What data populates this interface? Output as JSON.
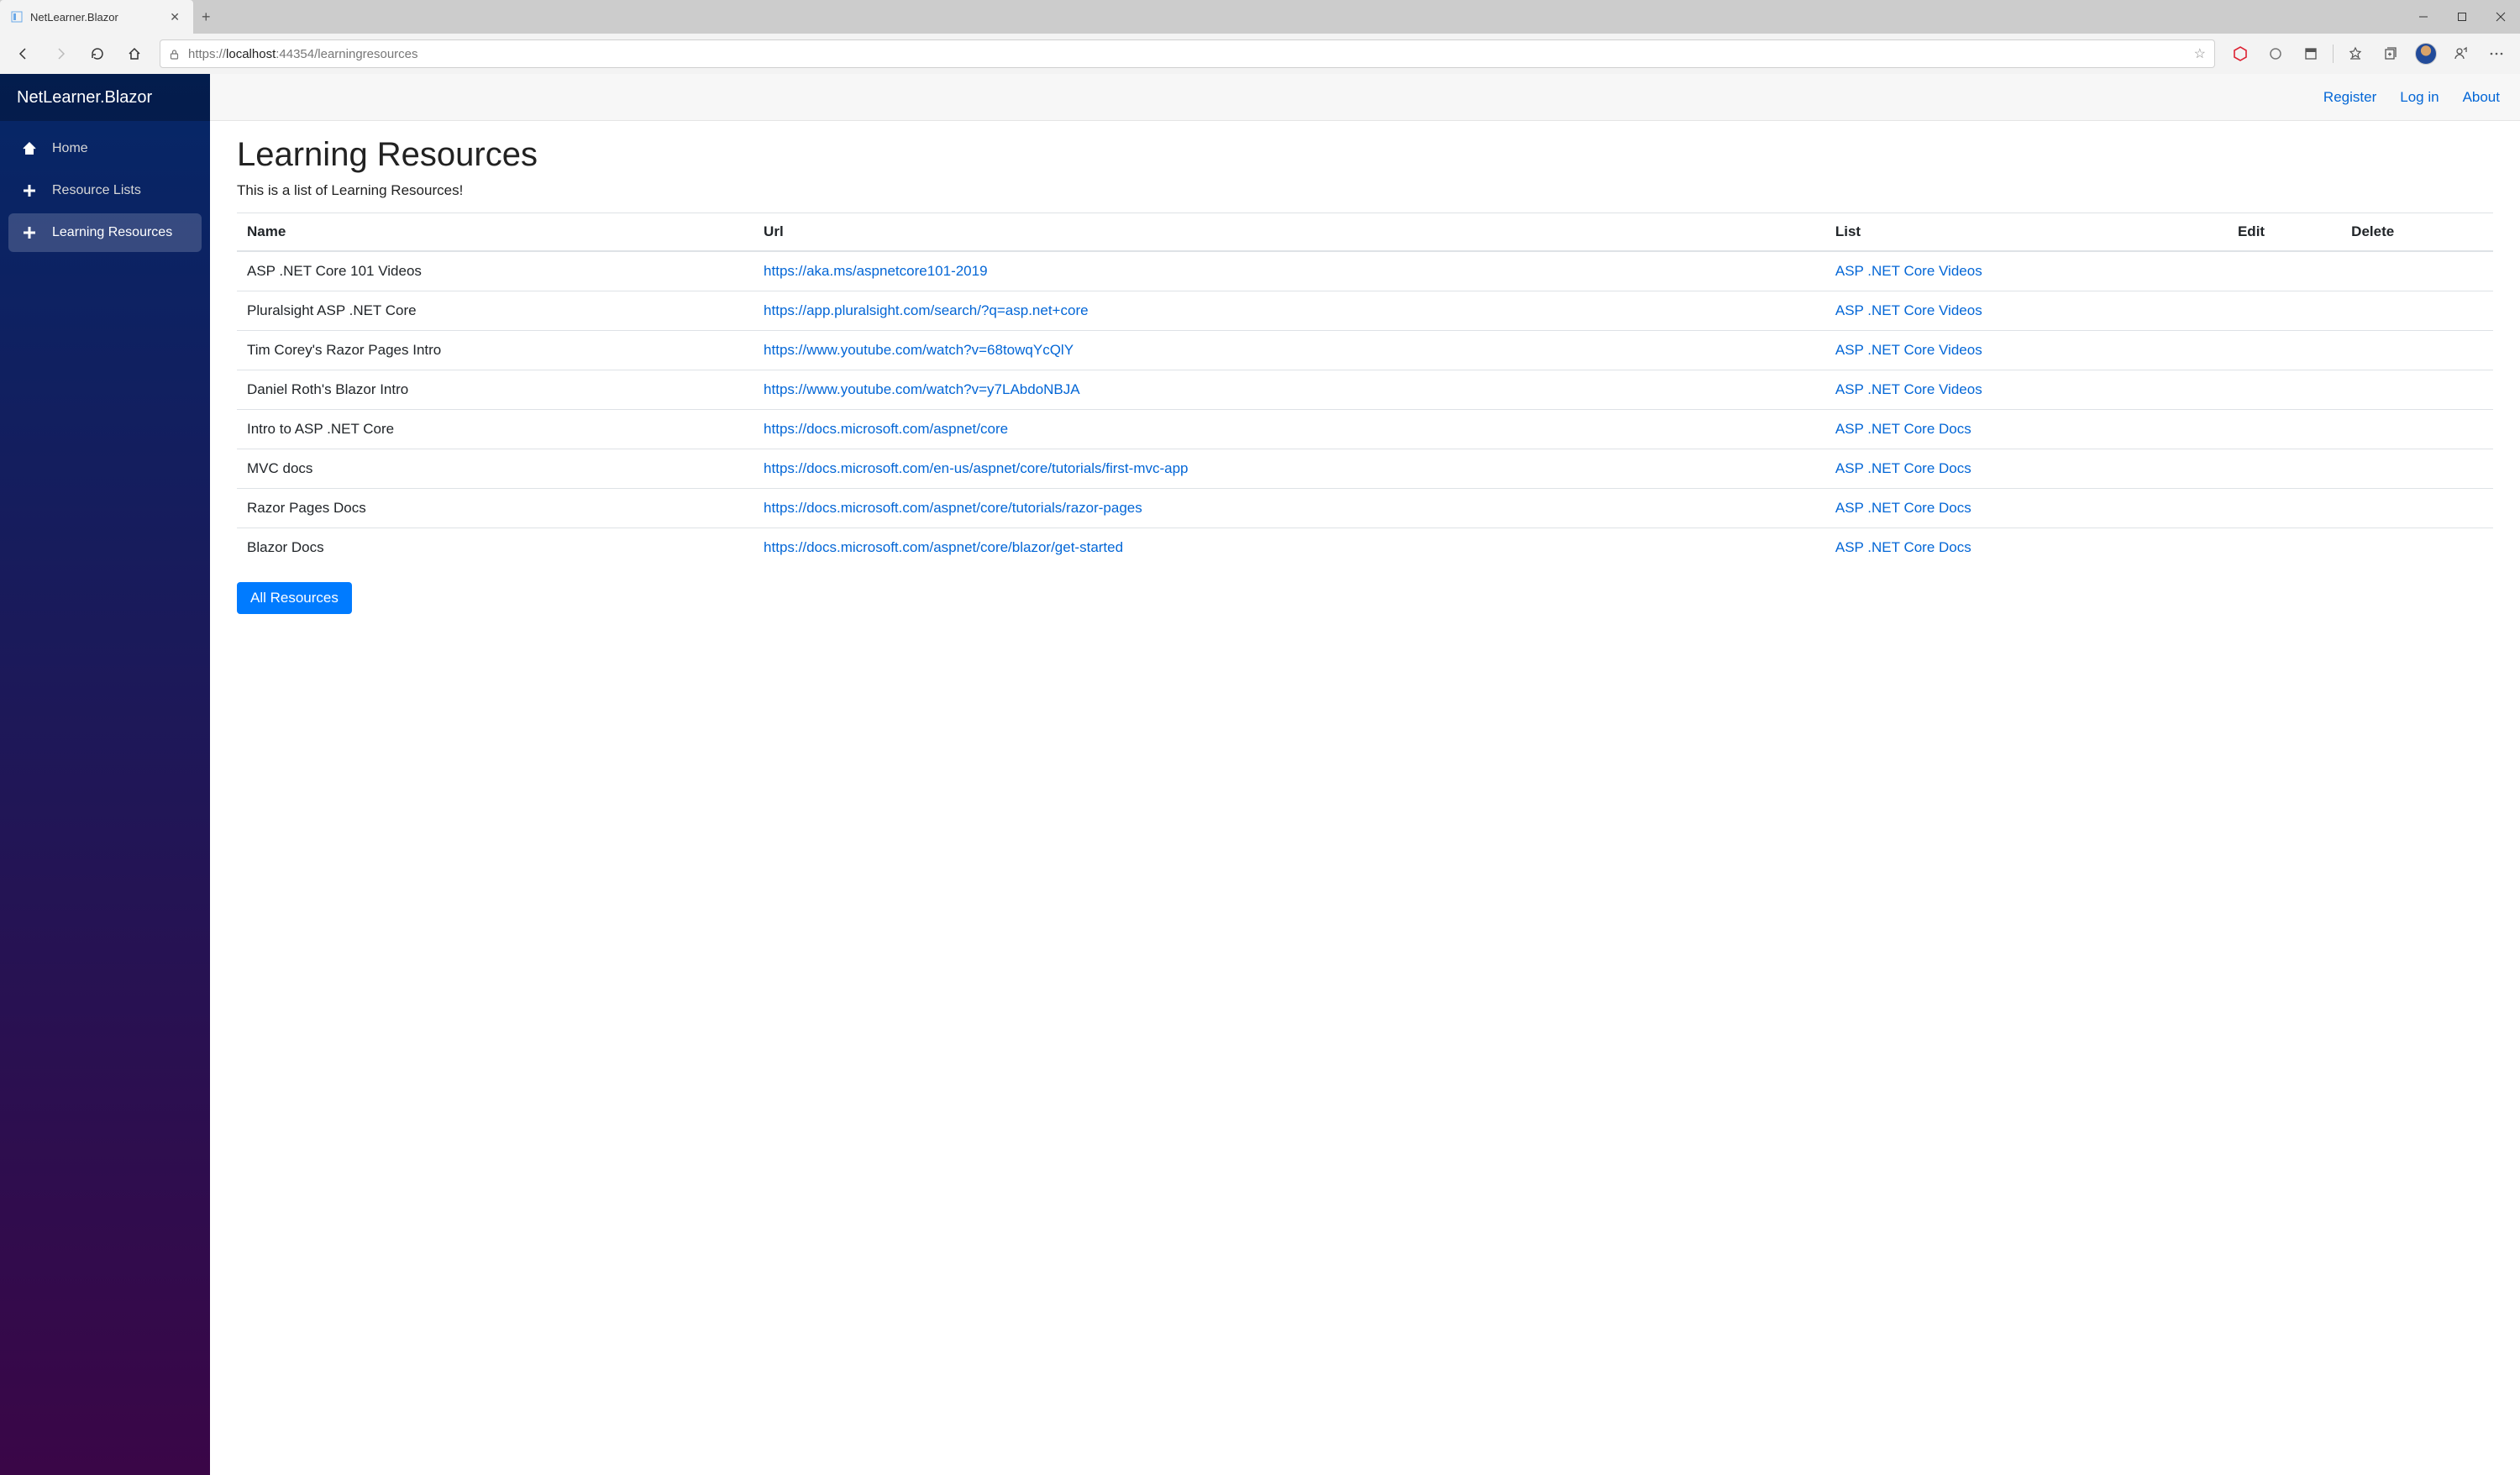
{
  "browser": {
    "tab_title": "NetLearner.Blazor",
    "url_prefix": "https://",
    "url_host": "localhost",
    "url_port": ":44354",
    "url_path": "/learningresources"
  },
  "sidebar": {
    "brand": "NetLearner.Blazor",
    "items": [
      {
        "label": "Home"
      },
      {
        "label": "Resource Lists"
      },
      {
        "label": "Learning Resources"
      }
    ]
  },
  "topbar": {
    "register": "Register",
    "login": "Log in",
    "about": "About"
  },
  "page": {
    "heading": "Learning Resources",
    "subtitle": "This is a list of Learning Resources!",
    "all_button": "All Resources"
  },
  "table": {
    "headers": {
      "name": "Name",
      "url": "Url",
      "list": "List",
      "edit": "Edit",
      "delete": "Delete"
    },
    "rows": [
      {
        "name": "ASP .NET Core 101 Videos",
        "url": "https://aka.ms/aspnetcore101-2019",
        "list": "ASP .NET Core Videos"
      },
      {
        "name": "Pluralsight ASP .NET Core",
        "url": "https://app.pluralsight.com/search/?q=asp.net+core",
        "list": "ASP .NET Core Videos"
      },
      {
        "name": "Tim Corey's Razor Pages Intro",
        "url": "https://www.youtube.com/watch?v=68towqYcQlY",
        "list": "ASP .NET Core Videos"
      },
      {
        "name": "Daniel Roth's Blazor Intro",
        "url": "https://www.youtube.com/watch?v=y7LAbdoNBJA",
        "list": "ASP .NET Core Videos"
      },
      {
        "name": "Intro to ASP .NET Core",
        "url": "https://docs.microsoft.com/aspnet/core",
        "list": "ASP .NET Core Docs"
      },
      {
        "name": "MVC docs",
        "url": "https://docs.microsoft.com/en-us/aspnet/core/tutorials/first-mvc-app",
        "list": "ASP .NET Core Docs"
      },
      {
        "name": "Razor Pages Docs",
        "url": "https://docs.microsoft.com/aspnet/core/tutorials/razor-pages",
        "list": "ASP .NET Core Docs"
      },
      {
        "name": "Blazor Docs",
        "url": "https://docs.microsoft.com/aspnet/core/blazor/get-started",
        "list": "ASP .NET Core Docs"
      }
    ]
  }
}
